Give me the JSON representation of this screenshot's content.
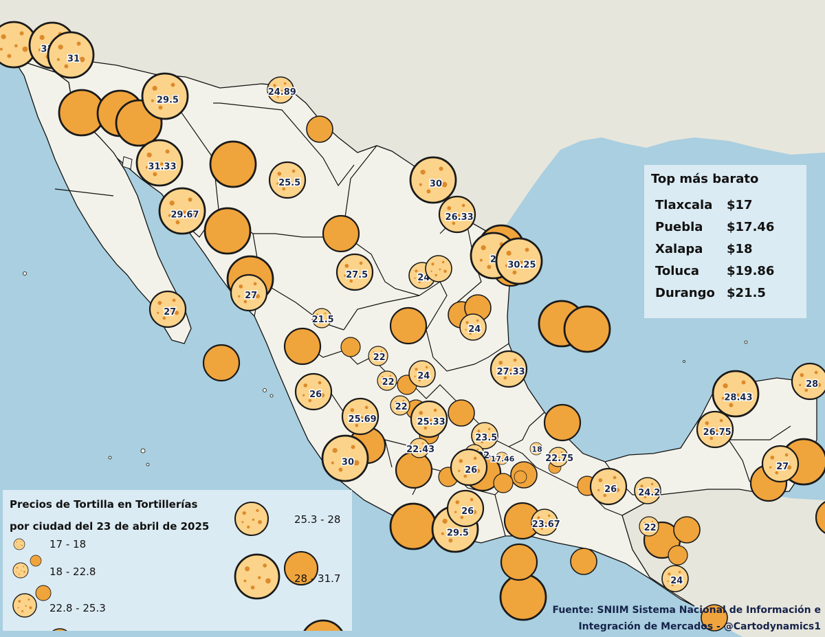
{
  "map": {
    "colors": {
      "ocean": "#a9cfe0",
      "land_other": "#e7e6dc",
      "land_mexico": "#f3f2ea",
      "border": "#111111",
      "tortilla_fill": "#fbd38a",
      "tortilla_edge": "#f0a43c",
      "tortilla_spot": "#dd8a2a",
      "outline": "#1a1a1a",
      "label": "#1a2748"
    },
    "icon": "tortilla-icon"
  },
  "markers": [
    {
      "label": "",
      "value": 30.0
    },
    {
      "label": "31.71",
      "value": 31.71
    },
    {
      "label": "31",
      "value": 31.0
    },
    {
      "label": "29.5",
      "value": 29.5
    },
    {
      "label": "24.89",
      "value": 24.89
    },
    {
      "label": "31.33",
      "value": 31.33
    },
    {
      "label": "29.67",
      "value": 29.67
    },
    {
      "label": "25.5",
      "value": 25.5
    },
    {
      "label": "30",
      "value": 30.0
    },
    {
      "label": "26.33",
      "value": 26.33
    },
    {
      "label": "29",
      "value": 29.0
    },
    {
      "label": "30.25",
      "value": 30.25
    },
    {
      "label": "27.5",
      "value": 27.5
    },
    {
      "label": "24",
      "value": 24.0
    },
    {
      "label": "",
      "value": 24.0
    },
    {
      "label": "27",
      "value": 27.0
    },
    {
      "label": "27",
      "value": 27.0
    },
    {
      "label": "21.5",
      "value": 21.5
    },
    {
      "label": "24",
      "value": 24.0
    },
    {
      "label": "27.33",
      "value": 27.33
    },
    {
      "label": "22",
      "value": 22.0
    },
    {
      "label": "22",
      "value": 22.0
    },
    {
      "label": "24",
      "value": 24.0
    },
    {
      "label": "22",
      "value": 22.0
    },
    {
      "label": "26",
      "value": 26.0
    },
    {
      "label": "25.69",
      "value": 25.69
    },
    {
      "label": "25.33",
      "value": 25.33
    },
    {
      "label": "22.43",
      "value": 22.43
    },
    {
      "label": "23.5",
      "value": 23.5
    },
    {
      "label": "30",
      "value": 30.0
    },
    {
      "label": "21.92",
      "value": 21.92
    },
    {
      "label": "26",
      "value": 26.0
    },
    {
      "label": "17.46",
      "value": 17.46
    },
    {
      "label": "18",
      "value": 18.0
    },
    {
      "label": "22.75",
      "value": 22.75
    },
    {
      "label": "26",
      "value": 26.0
    },
    {
      "label": "29.5",
      "value": 29.5
    },
    {
      "label": "23.67",
      "value": 23.67
    },
    {
      "label": "26",
      "value": 26.0
    },
    {
      "label": "24.2",
      "value": 24.2
    },
    {
      "label": "22",
      "value": 22.0
    },
    {
      "label": "28.43",
      "value": 28.43
    },
    {
      "label": "26.75",
      "value": 26.75
    },
    {
      "label": "28",
      "value": 28.0
    },
    {
      "label": "27",
      "value": 27.0
    },
    {
      "label": "24",
      "value": 24.0
    }
  ],
  "top_panel": {
    "title": "Top más barato",
    "rows": [
      {
        "city": "Tlaxcala",
        "price": "$17"
      },
      {
        "city": "Puebla",
        "price": "$17.46"
      },
      {
        "city": "Xalapa",
        "price": "$18"
      },
      {
        "city": "Toluca",
        "price": "$19.86"
      },
      {
        "city": "Durango",
        "price": "$21.5"
      }
    ]
  },
  "legend": {
    "title_line1": "Precios de Tortilla en Tortillerías",
    "title_line2": "por ciudad del 23 de abril de 2025",
    "classes": [
      {
        "label": "17 - 18"
      },
      {
        "label": "18 - 22.8"
      },
      {
        "label": "22.8 - 25.3"
      },
      {
        "label": "25.3 - 28"
      },
      {
        "label": "28 - 31.7"
      }
    ]
  },
  "source": {
    "line1": "Fuente: SNIIM Sistema Nacional de Información e",
    "line2": "Integración de Mercados - @Cartodynamics1"
  }
}
